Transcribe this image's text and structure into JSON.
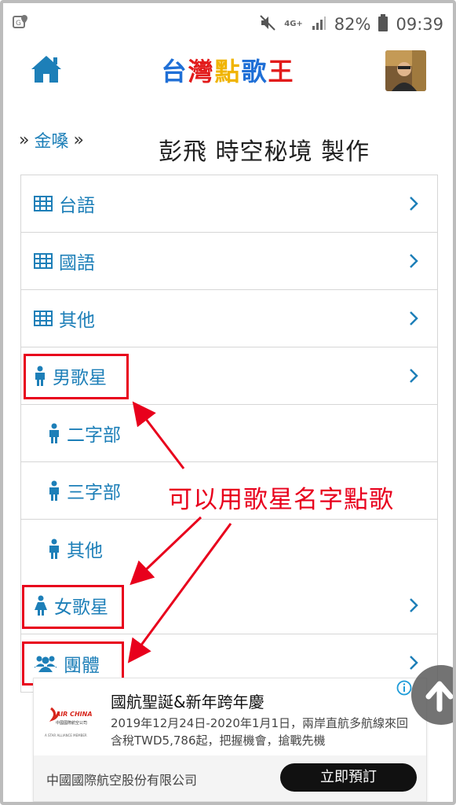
{
  "status_bar": {
    "network": "4G+",
    "battery": "82%",
    "time": "09:39"
  },
  "header": {
    "title_chars": [
      {
        "char": "台",
        "color": "#1f6fd6"
      },
      {
        "char": "灣",
        "color": "#e21b1b"
      },
      {
        "char": "點",
        "color": "#f0b400"
      },
      {
        "char": "歌",
        "color": "#1f6fd6"
      },
      {
        "char": "王",
        "color": "#e21b1b"
      }
    ],
    "home_icon": "home-icon",
    "avatar": "user-avatar"
  },
  "breadcrumb": {
    "prefix": "»",
    "link": "金嗓",
    "suffix": "»"
  },
  "page_title": "彭飛 時空秘境 製作",
  "menu": {
    "items": [
      {
        "label": "台語",
        "icon": "table-icon"
      },
      {
        "label": "國語",
        "icon": "table-icon"
      },
      {
        "label": "其他",
        "icon": "table-icon"
      },
      {
        "label": "男歌星",
        "icon": "male-icon"
      },
      {
        "label": "二字部",
        "icon": "male-icon"
      },
      {
        "label": "三字部",
        "icon": "male-icon"
      },
      {
        "label": "其他",
        "icon": "male-icon"
      },
      {
        "label": "女歌星",
        "icon": "female-icon"
      },
      {
        "label": "團體",
        "icon": "group-icon"
      }
    ]
  },
  "annotation": "可以用歌星名字點歌",
  "ad": {
    "title": "國航聖誕&新年跨年慶",
    "body": "2019年12月24日-2020年1月1日，兩岸直航多航線來回含稅TWD5,786起，把握機會，搶戰先機",
    "logo_text": "AIR CHINA",
    "logo_sub": "中國國際航空公司",
    "logo_alliance": "A STAR ALLIANCE MEMBER",
    "company": "中國國際航空股份有限公司",
    "cta": "立即預訂"
  },
  "colors": {
    "accent": "#1d7fb8",
    "highlight": "#e8001c"
  }
}
